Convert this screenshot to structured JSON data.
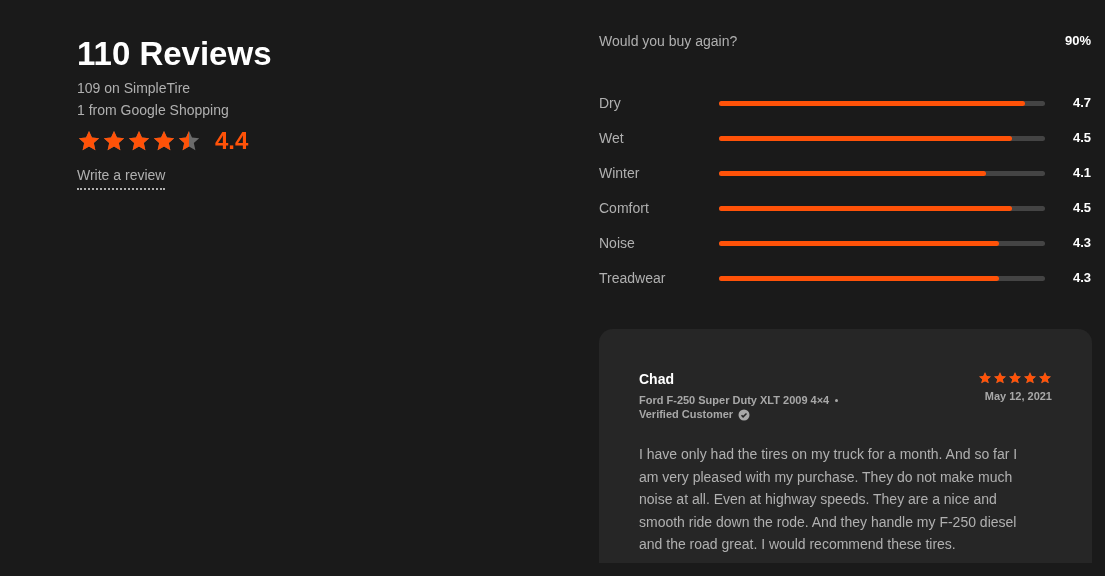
{
  "summary": {
    "title": "110 Reviews",
    "sources": [
      "109 on SimpleTire",
      "1 from Google Shopping"
    ],
    "stars": 4.4,
    "rating": "4.4",
    "write_link": "Write a review"
  },
  "buy_again": {
    "label": "Would you buy again?",
    "value": "90%"
  },
  "ratings": [
    {
      "label": "Dry",
      "level": 0.94,
      "value": "4.7"
    },
    {
      "label": "Wet",
      "level": 0.9,
      "value": "4.5"
    },
    {
      "label": "Winter",
      "level": 0.82,
      "value": "4.1"
    },
    {
      "label": "Comfort",
      "level": 0.9,
      "value": "4.5"
    },
    {
      "label": "Noise",
      "level": 0.86,
      "value": "4.3"
    },
    {
      "label": "Treadwear",
      "level": 0.86,
      "value": "4.3"
    }
  ],
  "review": {
    "author": "Chad",
    "vehicle": "Ford F-250 Super Duty XLT 2009 4×4",
    "verified": true,
    "verified_label": "Verified Customer",
    "stars": 5,
    "date": "May 12, 2021",
    "text": "I have only had the tires on my truck for a month. And so far I am very pleased with my purchase. They do not make much noise at all. Even at highway speeds. They are a nice and smooth ride down the rode. And they handle my F-250 diesel and the road great. I would recommend these tires."
  }
}
